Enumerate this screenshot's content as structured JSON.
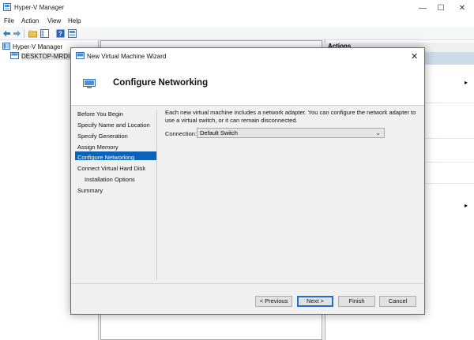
{
  "app": {
    "title": "Hyper-V Manager",
    "menu": [
      "File",
      "Action",
      "View",
      "Help"
    ]
  },
  "tree": {
    "root": "Hyper-V Manager",
    "host": "DESKTOP-MRDINK"
  },
  "actions": {
    "header": "Actions"
  },
  "dialog": {
    "title": "New Virtual Machine Wizard",
    "heading": "Configure Networking",
    "nav": [
      "Before You Begin",
      "Specify Name and Location",
      "Specify Generation",
      "Assign Memory",
      "Configure Networking",
      "Connect Virtual Hard Disk",
      "Installation Options",
      "Summary"
    ],
    "description": "Each new virtual machine includes a network adapter. You can configure the network adapter to use a virtual switch, or it can remain disconnected.",
    "connection_label": "Connection:",
    "connection_value": "Default Switch",
    "buttons": {
      "previous": "< Previous",
      "next": "Next >",
      "finish": "Finish",
      "cancel": "Cancel"
    }
  },
  "colors": {
    "selection": "#0a63b8",
    "accent_border": "#1e70c8"
  }
}
